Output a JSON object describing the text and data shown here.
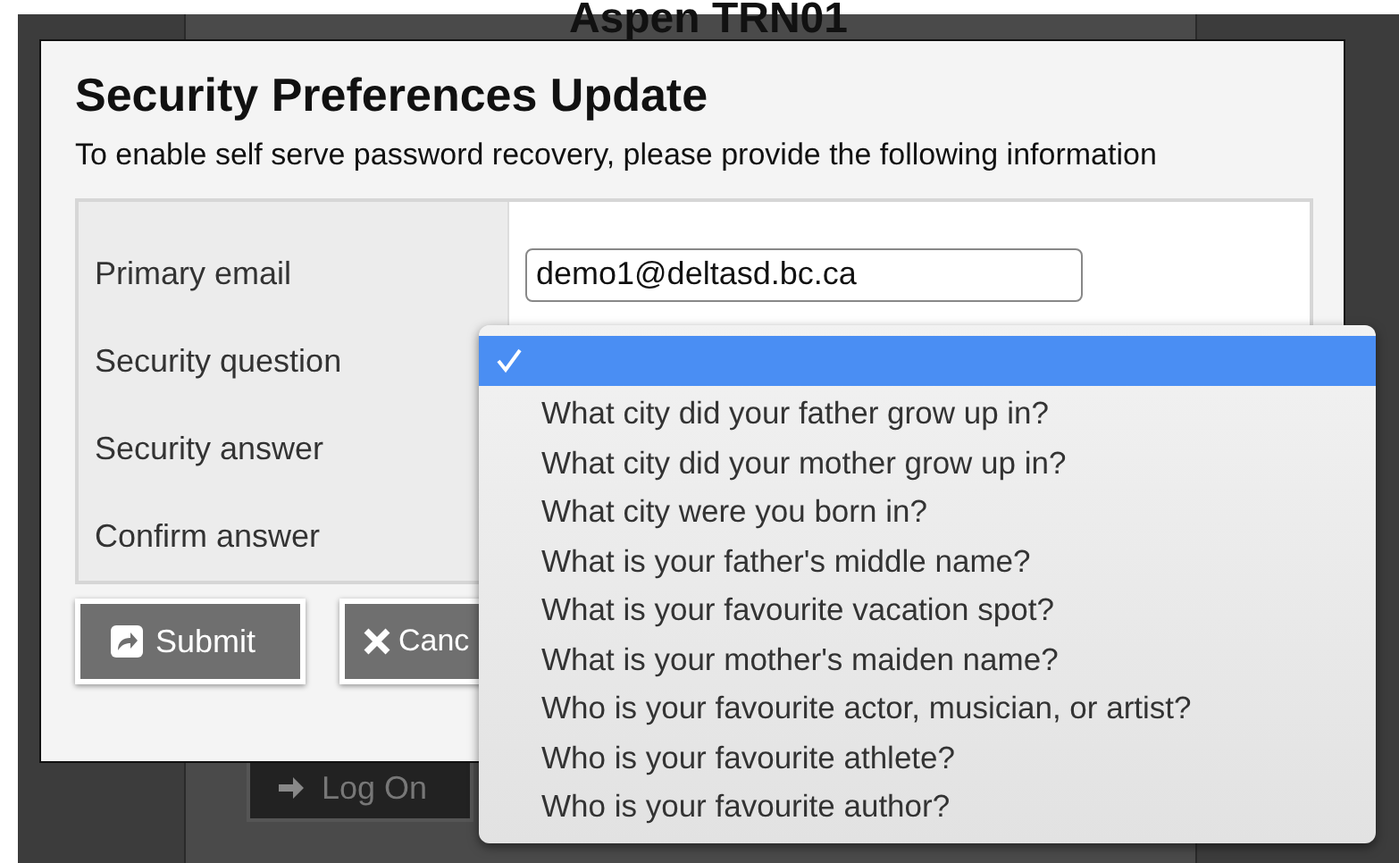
{
  "background": {
    "heading": "Aspen TRN01",
    "button": "Log On"
  },
  "dialog": {
    "title": "Security Preferences Update",
    "instructions": "To enable self serve password recovery, please provide the following information",
    "fields": [
      {
        "label": "Primary email",
        "kind": "input",
        "value": "demo1@deltasd.bc.ca"
      },
      {
        "label": "Security question",
        "kind": "covered"
      },
      {
        "label": "Security answer",
        "kind": "covered"
      },
      {
        "label": "Confirm answer",
        "kind": "covered"
      }
    ],
    "buttons": [
      {
        "label": "Submit",
        "kind": "submit"
      },
      {
        "label": "Canc",
        "kind": "cancel"
      }
    ]
  },
  "dropdown": {
    "options": [
      {
        "selected": true
      },
      {
        "label": "What city did your father grow up in?",
        "selected": false
      },
      {
        "label": "What city did your mother grow up in?",
        "selected": false
      },
      {
        "label": "What city were you born in?",
        "selected": false
      },
      {
        "label": "What is your father's middle name?",
        "selected": false
      },
      {
        "label": "What is your favourite vacation spot?",
        "selected": false
      },
      {
        "label": "What is your mother's maiden name?",
        "selected": false
      },
      {
        "label": "Who is your favourite actor, musician, or artist?",
        "selected": false
      },
      {
        "label": "Who is your favourite athlete?",
        "selected": false
      },
      {
        "label": "Who is your favourite author?",
        "selected": false
      }
    ]
  }
}
